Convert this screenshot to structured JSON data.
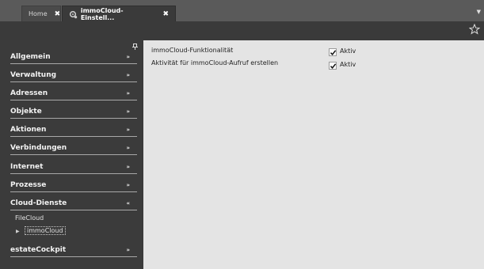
{
  "tabs": [
    {
      "label": "Home",
      "close": "✖"
    },
    {
      "label": "immoCloud-Einstell...",
      "close": "✖"
    }
  ],
  "tab_menu_icon": "dropdown-arrow-icon",
  "toolbar": {
    "star_icon": "star-icon"
  },
  "sidebar": {
    "pin_icon": "pin-icon",
    "sections": [
      {
        "label": "Allgemein",
        "chevron": "»"
      },
      {
        "label": "Verwaltung",
        "chevron": "»"
      },
      {
        "label": "Adressen",
        "chevron": "»"
      },
      {
        "label": "Objekte",
        "chevron": "»"
      },
      {
        "label": "Aktionen",
        "chevron": "»"
      },
      {
        "label": "Verbindungen",
        "chevron": "»"
      },
      {
        "label": "Internet",
        "chevron": "»"
      },
      {
        "label": "Prozesse",
        "chevron": "»"
      },
      {
        "label": "Cloud-Dienste",
        "chevron": "«"
      },
      {
        "label": "estateCockpit",
        "chevron": "»"
      }
    ],
    "cloud_items": [
      {
        "label": "FileCloud"
      },
      {
        "label": "immoCloud"
      }
    ]
  },
  "content": {
    "rows": [
      {
        "label": "immoCloud-Funktionalität",
        "checked": true,
        "value": "Aktiv"
      },
      {
        "label": "Aktivität für immoCloud-Aufruf erstellen",
        "checked": true,
        "value": "Aktiv"
      }
    ]
  }
}
